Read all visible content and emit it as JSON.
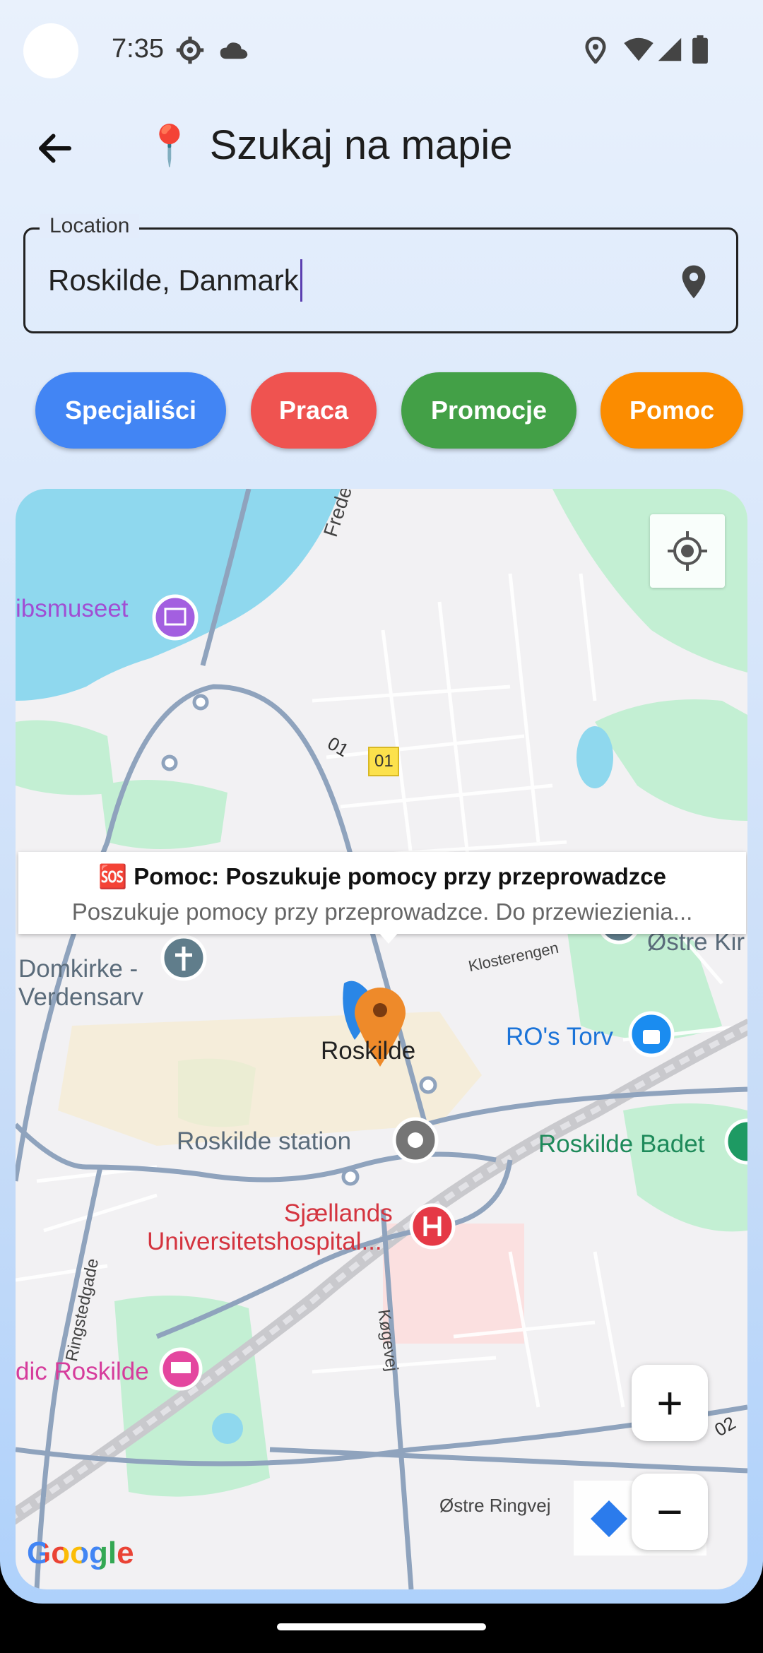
{
  "status_bar": {
    "time": "7:35"
  },
  "app_bar": {
    "title": "Szukaj na mapie",
    "title_icon": "📍"
  },
  "location_field": {
    "label": "Location",
    "value": "Roskilde, Danmark"
  },
  "chips": [
    {
      "label": "Specjaliści",
      "color": "#4285f4"
    },
    {
      "label": "Praca",
      "color": "#ef5350"
    },
    {
      "label": "Promocje",
      "color": "#43a047"
    },
    {
      "label": "Pomoc",
      "color": "#fb8c00"
    }
  ],
  "map": {
    "info_window": {
      "title": "🆘 Pomoc: Poszukuje pomocy przy przeprowadzce",
      "body": "Poszukuje pomocy przy przeprowadzce. Do przewiezienia..."
    },
    "labels": {
      "frederiksborg": "Frederiksborg",
      "museum": "ibsmuseet",
      "road_01a": "01",
      "road_01b": "01",
      "domkirke_1": "Domkirke -",
      "domkirke_2": "Verdensarv",
      "city": "Roskilde",
      "kloster": "Klosterengen",
      "ostre_kir": "Østre Kir",
      "ros_torv": "RO's Torv",
      "station": "Roskilde station",
      "badet": "Roskilde Badet",
      "hospital_1": "Sjællands",
      "hospital_2": "Universitetshospital...",
      "ringstedgade": "Ringstedgade",
      "kogevej": "Køgevej",
      "hotel": "dic Roskilde",
      "ostre_ringvej": "Østre Ringvej",
      "road_02": "02",
      "google": "Google"
    },
    "zoom_in": "+",
    "zoom_out": "−"
  }
}
